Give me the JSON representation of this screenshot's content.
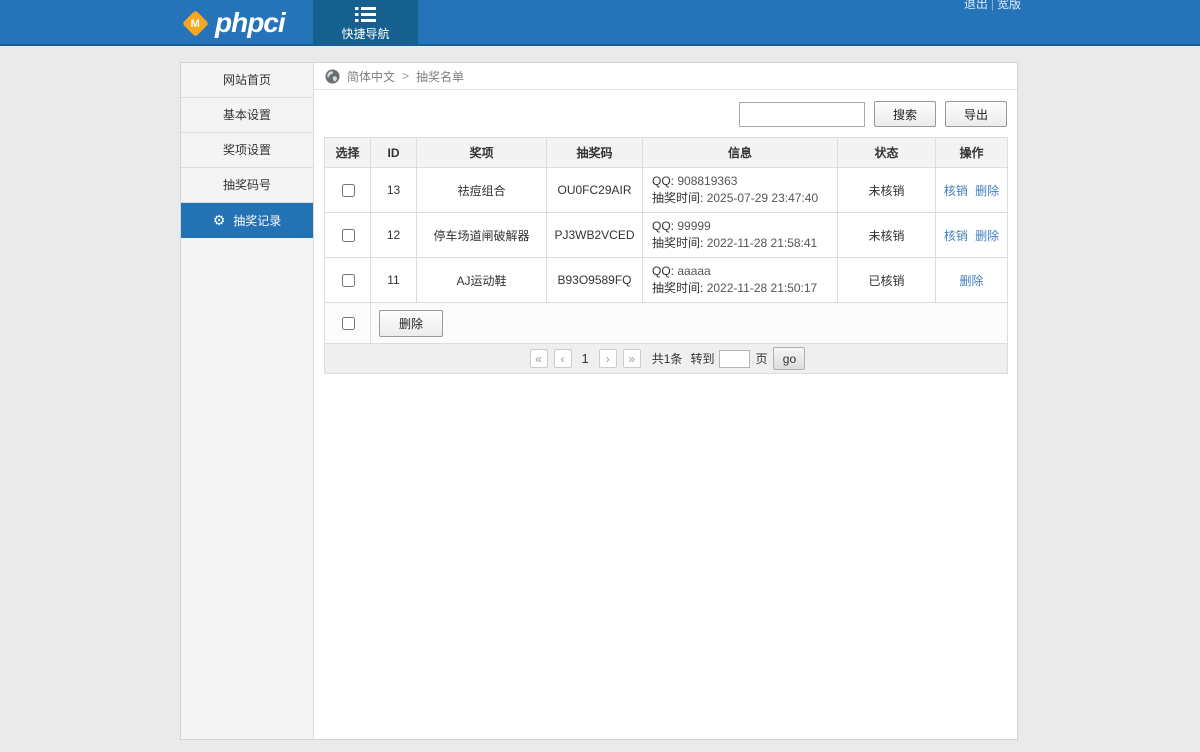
{
  "header": {
    "logo_text": "phpci",
    "logo_badge": "M",
    "nav_tab_label": "快捷导航",
    "logout_label": "退出",
    "links_separator": "|",
    "wide_label": "宽版"
  },
  "sidebar": {
    "items": [
      {
        "label": "网站首页",
        "active": false
      },
      {
        "label": "基本设置",
        "active": false
      },
      {
        "label": "奖项设置",
        "active": false
      },
      {
        "label": "抽奖码号",
        "active": false
      },
      {
        "label": "抽奖记录",
        "active": true
      }
    ]
  },
  "breadcrumb": {
    "lang": "简体中文",
    "separator": ">",
    "page": "抽奖名单"
  },
  "toolbar": {
    "search_value": "",
    "search_label": "搜索",
    "export_label": "导出"
  },
  "table": {
    "headers": [
      "选择",
      "ID",
      "奖项",
      "抽奖码",
      "信息",
      "状态",
      "操作"
    ],
    "rows": [
      {
        "id": "13",
        "prize": "祛痘组合",
        "code": "OU0FC29AIR",
        "qq_label": "QQ:",
        "qq": "908819363",
        "time_label": "抽奖时间:",
        "time": "2025-07-29 23:47:40",
        "status": "未核销",
        "actions": [
          "核销",
          "删除"
        ]
      },
      {
        "id": "12",
        "prize": "停车场道闸破解器",
        "code": "PJ3WB2VCED",
        "qq_label": "QQ:",
        "qq": "99999",
        "time_label": "抽奖时间:",
        "time": "2022-11-28 21:58:41",
        "status": "未核销",
        "actions": [
          "核销",
          "删除"
        ]
      },
      {
        "id": "11",
        "prize": "AJ运动鞋",
        "code": "B93O9589FQ",
        "qq_label": "QQ:",
        "qq": "aaaaa",
        "time_label": "抽奖时间:",
        "time": "2022-11-28 21:50:17",
        "status": "已核销",
        "actions": [
          "删除"
        ]
      }
    ],
    "bulk_delete_label": "删除"
  },
  "pagination": {
    "first": "«",
    "prev": "‹",
    "current": "1",
    "next": "›",
    "last": "»",
    "total": "共1条",
    "goto": "转到",
    "goto_value": "",
    "page_unit": "页",
    "go": "go"
  },
  "colors": {
    "header_blue": "#2573b9",
    "tab_blue": "#15608f",
    "active_blue": "#2372b4",
    "link_blue": "#4180be"
  }
}
